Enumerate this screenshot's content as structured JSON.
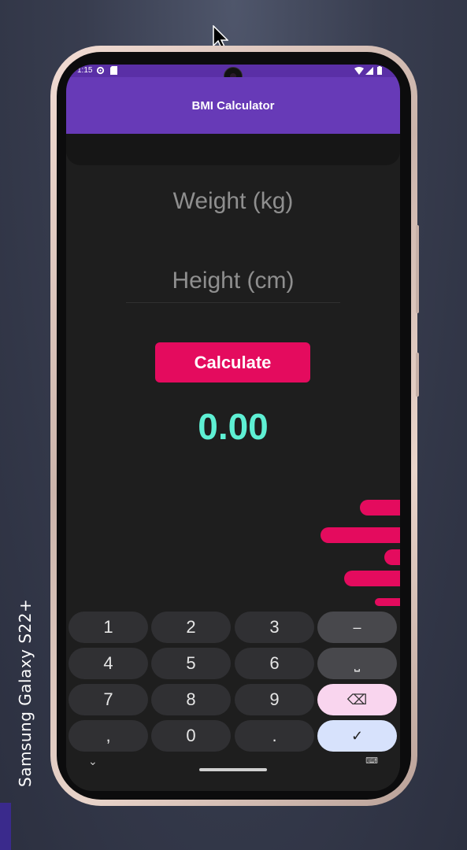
{
  "device": {
    "label": "Samsung Galaxy  S22+"
  },
  "statusbar": {
    "time": "1:15"
  },
  "appbar": {
    "title": "BMI Calculator"
  },
  "form": {
    "weight_placeholder": "Weight (kg)",
    "height_placeholder": "Height (cm)",
    "calculate_label": "Calculate"
  },
  "result": {
    "value": "0.00"
  },
  "colors": {
    "appbar": "#673ab7",
    "accent": "#e40b5e",
    "result": "#5ef0d4",
    "background": "#1e1e1e"
  },
  "keyboard": {
    "rows": [
      [
        "1",
        "2",
        "3",
        "–"
      ],
      [
        "4",
        "5",
        "6",
        "⎵"
      ],
      [
        "7",
        "8",
        "9",
        "⌫"
      ],
      [
        ",",
        "0",
        ".",
        "✓"
      ]
    ]
  },
  "icons": [
    "settings-icon",
    "sd-card-icon",
    "wifi-icon",
    "signal-icon",
    "battery-icon",
    "cursor-icon",
    "chevron-down-icon",
    "keyboard-icon"
  ]
}
